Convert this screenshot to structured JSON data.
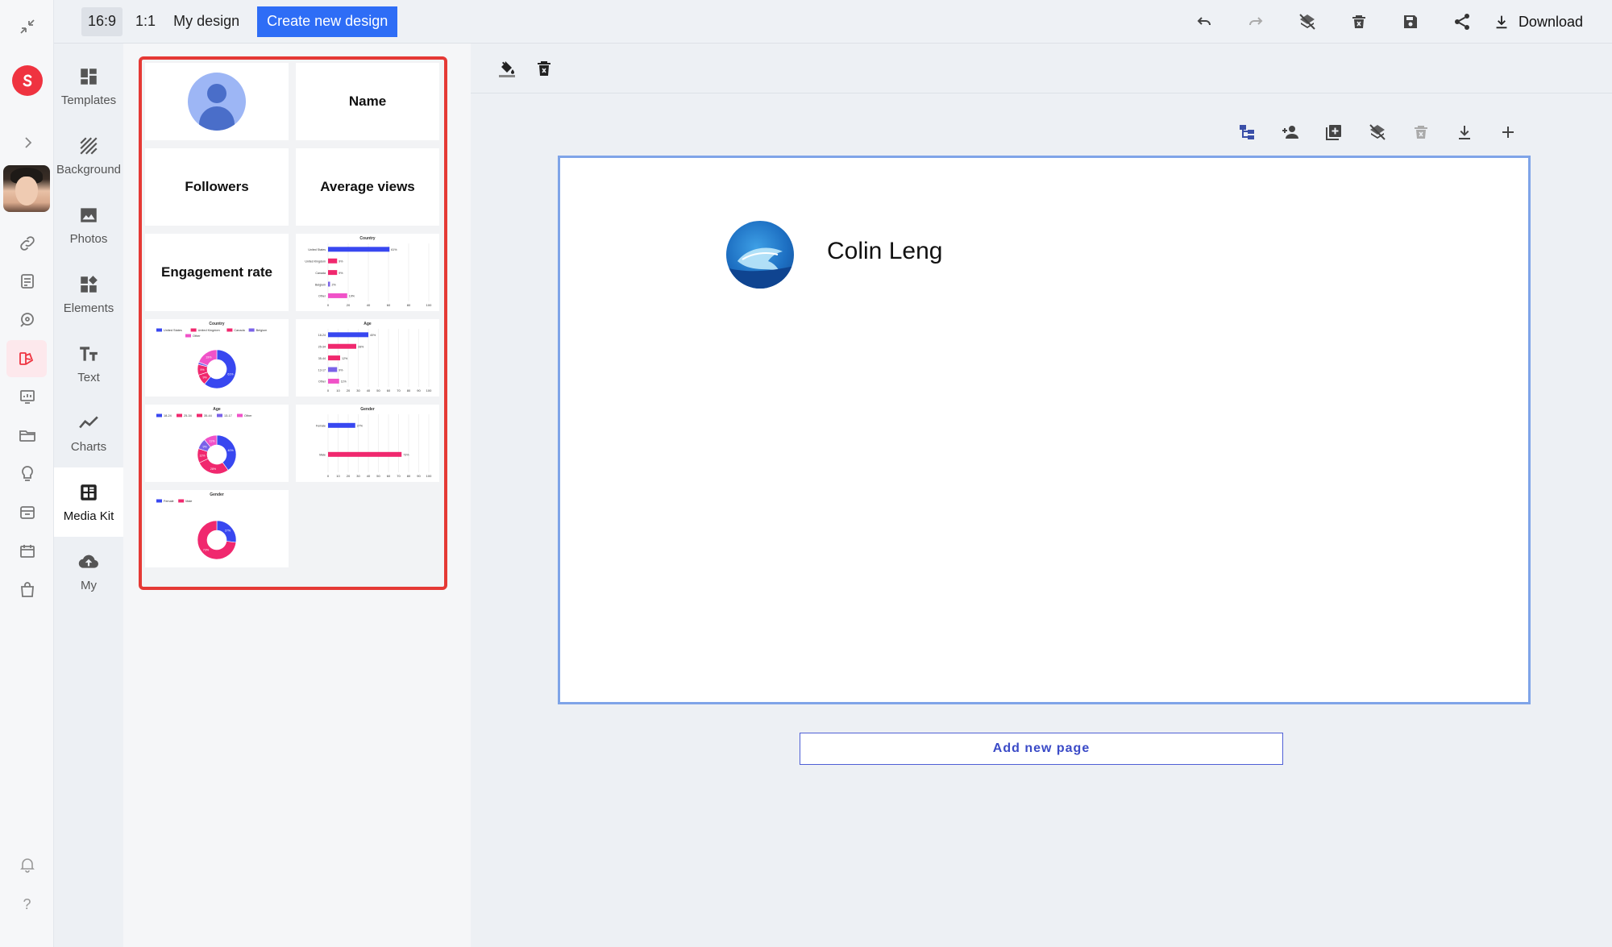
{
  "topbar": {
    "ratio_wide": "16:9",
    "ratio_square": "1:1",
    "design_title": "My design",
    "create_label": "Create new design",
    "download_label": "Download",
    "icons": [
      "undo-icon",
      "redo-icon",
      "layers-off-icon",
      "delete-icon",
      "save-icon",
      "share-icon",
      "download-icon"
    ]
  },
  "rail": {
    "icons": [
      "collapse-icon",
      "logo-icon",
      "chevron-right-icon",
      "user-avatar",
      "link-icon",
      "notes-icon",
      "chat-search-icon",
      "design-icon",
      "presentation-icon",
      "folder-icon",
      "bulb-icon",
      "storage-icon",
      "calendar-icon",
      "shop-icon",
      "bell-icon",
      "help-icon"
    ],
    "help_label": "?"
  },
  "categories": [
    {
      "label": "Templates",
      "icon": "templates-icon"
    },
    {
      "label": "Background",
      "icon": "background-icon"
    },
    {
      "label": "Photos",
      "icon": "photos-icon"
    },
    {
      "label": "Elements",
      "icon": "elements-icon"
    },
    {
      "label": "Text",
      "icon": "text-icon"
    },
    {
      "label": "Charts",
      "icon": "charts-icon"
    },
    {
      "label": "Media Kit",
      "icon": "media-kit-icon"
    },
    {
      "label": "My",
      "icon": "cloud-upload-icon"
    }
  ],
  "active_category": "Media Kit",
  "panel": {
    "tiles": {
      "name": "Name",
      "followers": "Followers",
      "average_views": "Average views",
      "engagement_rate": "Engagement rate"
    },
    "country_bar": {
      "title": "Country",
      "rows": [
        {
          "label": "United States",
          "value": 61
        },
        {
          "label": "United Kingdom",
          "value": 9
        },
        {
          "label": "Canada",
          "value": 9
        },
        {
          "label": "Belgium",
          "value": 2
        },
        {
          "label": "Other",
          "value": 19
        }
      ],
      "ticks": [
        "0",
        "20",
        "40",
        "60",
        "80",
        "100"
      ]
    },
    "country_donut": {
      "title": "Country",
      "legend": [
        "United States",
        "United Kingdom",
        "Canada",
        "Belgium",
        "Other"
      ],
      "values": [
        61,
        9,
        9,
        2,
        19
      ]
    },
    "age_bar": {
      "title": "Age",
      "rows": [
        {
          "label": "18-24",
          "value": 40
        },
        {
          "label": "25-34",
          "value": 28
        },
        {
          "label": "35-44",
          "value": 12
        },
        {
          "label": "13-17",
          "value": 9
        },
        {
          "label": "Other",
          "value": 11
        }
      ],
      "ticks": [
        "0",
        "10",
        "20",
        "30",
        "40",
        "50",
        "60",
        "70",
        "80",
        "90",
        "100"
      ]
    },
    "age_donut": {
      "title": "Age",
      "legend": [
        "18-24",
        "25-34",
        "35-44",
        "13-17",
        "Other"
      ],
      "values": [
        40,
        28,
        12,
        9,
        11
      ]
    },
    "gender_bar": {
      "title": "Gender",
      "rows": [
        {
          "label": "Female",
          "value": 27
        },
        {
          "label": "Male",
          "value": 73
        }
      ],
      "ticks": [
        "0",
        "10",
        "20",
        "30",
        "40",
        "50",
        "60",
        "70",
        "80",
        "90",
        "100"
      ]
    },
    "gender_donut": {
      "title": "Gender",
      "legend": [
        "Female",
        "Male"
      ],
      "values": [
        27,
        73
      ]
    }
  },
  "canvas": {
    "tool_icons": [
      "fill-color-icon",
      "delete-icon"
    ],
    "page_tool_icons": [
      "hierarchy-icon",
      "add-person-icon",
      "add-page-icon",
      "layers-off-icon",
      "delete-icon",
      "download-icon",
      "plus-icon"
    ],
    "brand_name": "Colin Leng",
    "add_page_label": "Add new page"
  },
  "colors": {
    "primary": "#2e6df6",
    "highlight": "#e53935",
    "chart_blue": "#3847f0",
    "chart_pink": "#f0286e",
    "chart_magenta": "#f052c8",
    "chart_violet": "#7a62e8"
  }
}
